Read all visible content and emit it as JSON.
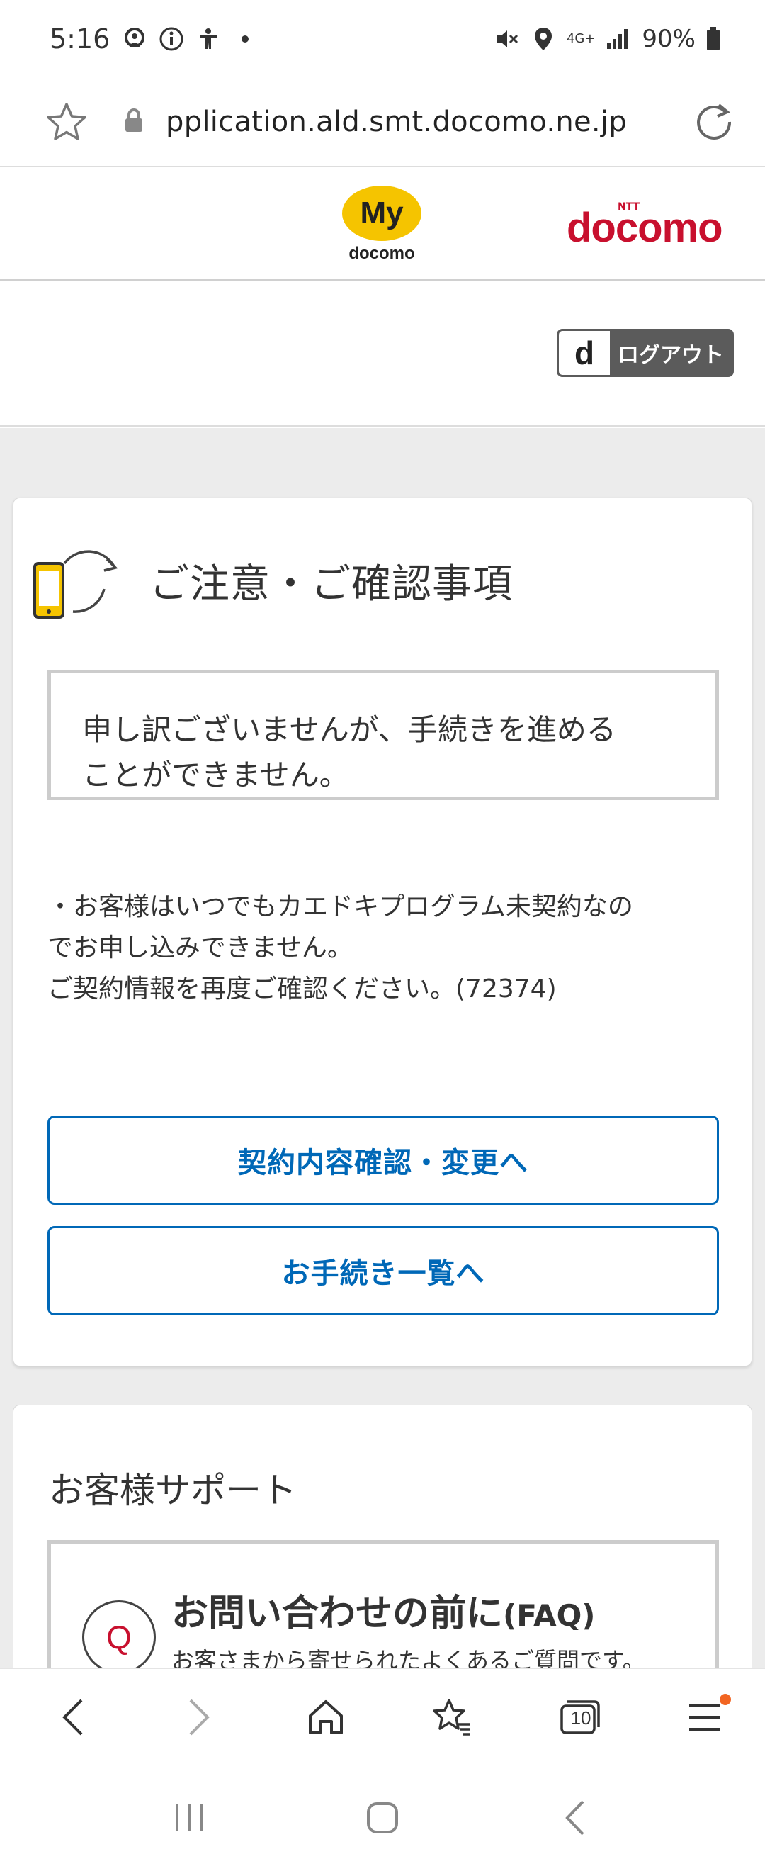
{
  "status_bar": {
    "time": "5:16",
    "battery": "90%",
    "network": "4G+"
  },
  "address_bar": {
    "url": "pplication.ald.smt.docomo.ne.jp"
  },
  "brand": {
    "my_logo_text": "My",
    "my_logo_sub": "docomo",
    "ntt_text": "NTT",
    "docomo_text": "docomo"
  },
  "account": {
    "logout_badge": "d",
    "logout_label": "ログアウト"
  },
  "notice": {
    "title": "ご注意・ご確認事項",
    "alert_lines": [
      "申し訳ございませんが、手続きを進める",
      "ことができません。"
    ],
    "detail_lines": [
      "・お客様はいつでもカエドキプログラム未契約なの",
      "でお申し込みできません。",
      "ご契約情報を再度ご確認ください。(72374)"
    ],
    "contract_button_label": "契約内容確認・変更へ",
    "procedures_button_label": "お手続き一覧へ"
  },
  "support": {
    "title": "お客様サポート",
    "faq_icon_letter": "Q",
    "faq_title": "お問い合わせの前に",
    "faq_title_suffix": "(FAQ)",
    "faq_description": "お客さまから寄せられたよくあるご質問です。"
  },
  "browser_toolbar": {
    "tab_count": "10"
  },
  "colors": {
    "accent_blue": "#0068b7",
    "docomo_red": "#c8102e",
    "my_yellow": "#f5c400",
    "page_grey": "#ececec",
    "notification_orange": "#f26522"
  },
  "icons": {
    "star": "bookmark-star-icon",
    "lock": "lock-icon",
    "reload": "reload-icon",
    "phone_cycle": "phone-cycle-icon",
    "back": "back-arrow-icon",
    "forward": "forward-arrow-icon",
    "home": "home-icon",
    "bookmarks": "bookmarks-icon",
    "tabs": "tabs-icon",
    "menu": "menu-icon"
  }
}
